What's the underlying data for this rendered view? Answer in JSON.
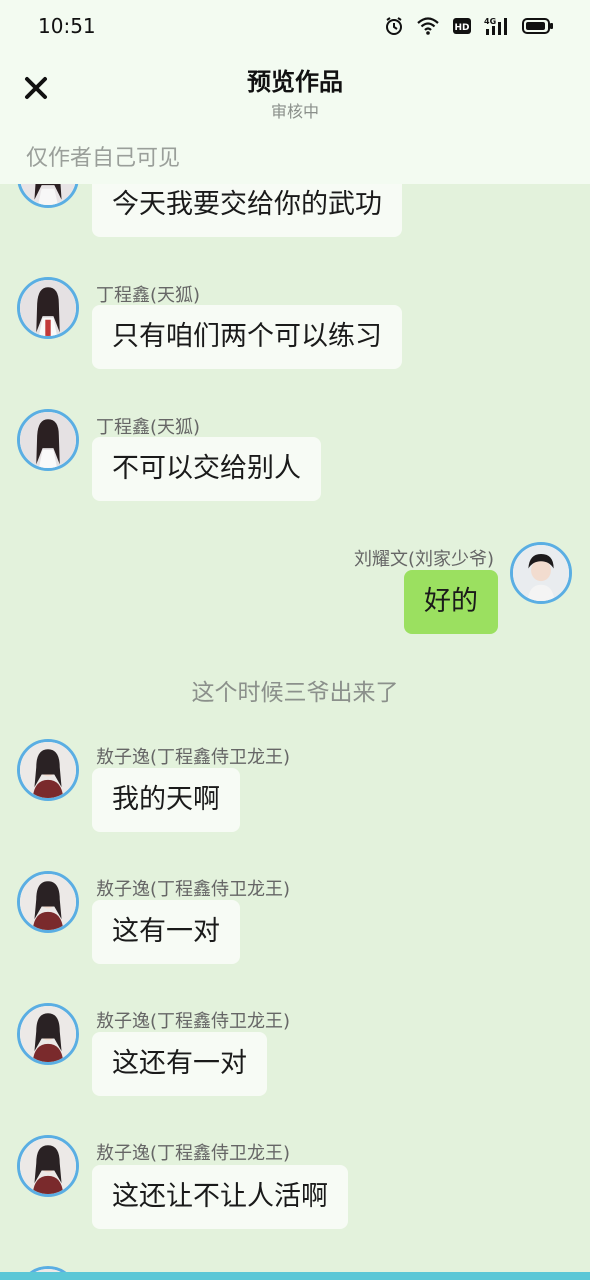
{
  "status_bar": {
    "time": "10:51",
    "icons": [
      "alarm-icon",
      "wifi-icon",
      "hd-icon",
      "signal-4g-icon",
      "battery-icon"
    ],
    "network_label": "4G"
  },
  "header": {
    "title": "预览作品",
    "subtitle": "审核中",
    "visibility_note": "仅作者自己可见"
  },
  "messages": [
    {
      "sender": "",
      "text": "今天我要交给你的武功",
      "side": "left"
    },
    {
      "sender": "丁程鑫(天狐)",
      "text": "只有咱们两个可以练习",
      "side": "left"
    },
    {
      "sender": "丁程鑫(天狐)",
      "text": "不可以交给别人",
      "side": "left"
    },
    {
      "sender": "刘耀文(刘家少爷)",
      "text": "好的",
      "side": "right"
    },
    {
      "narration": "这个时候三爷出来了"
    },
    {
      "sender": "敖子逸(丁程鑫侍卫龙王)",
      "text": "我的天啊",
      "side": "left"
    },
    {
      "sender": "敖子逸(丁程鑫侍卫龙王)",
      "text": "这有一对",
      "side": "left"
    },
    {
      "sender": "敖子逸(丁程鑫侍卫龙王)",
      "text": "这还有一对",
      "side": "left"
    },
    {
      "sender": "敖子逸(丁程鑫侍卫龙王)",
      "text": "这还让不让人活啊",
      "side": "left"
    }
  ],
  "colors": {
    "background": "#e3f2dc",
    "header_bg": "#f3fbf1",
    "bubble_left": "#f7fbf5",
    "bubble_right": "#9be060",
    "avatar_border": "#5aaee3"
  }
}
